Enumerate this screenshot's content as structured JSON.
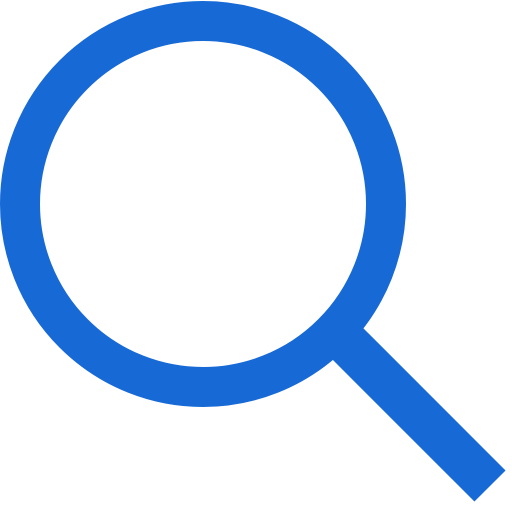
{
  "icon": {
    "name": "search-icon",
    "color": "#1769d6",
    "background": "#ffffff"
  }
}
